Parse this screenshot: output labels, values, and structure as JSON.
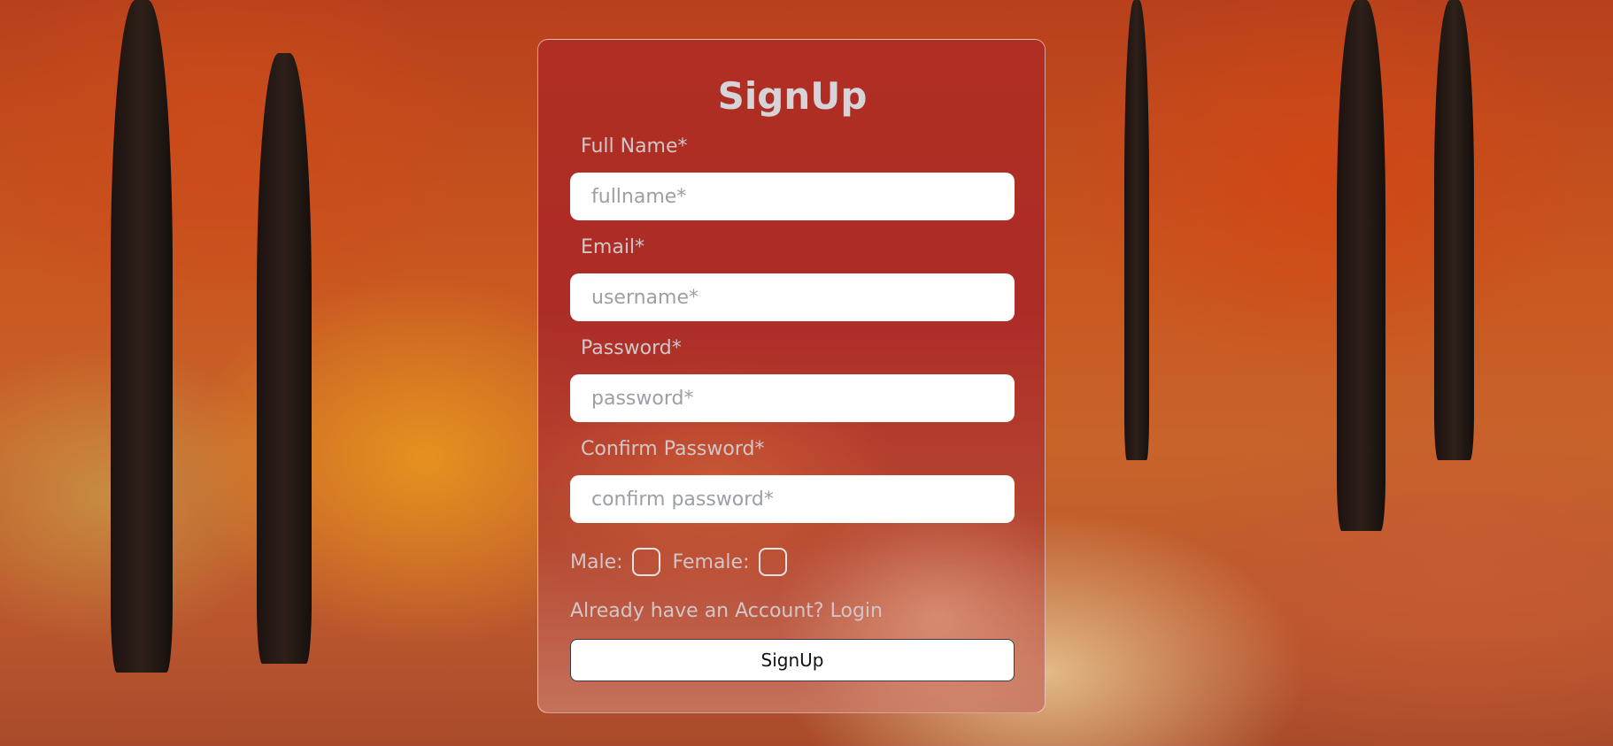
{
  "form": {
    "title": "SignUp",
    "fields": [
      {
        "label": "Full Name*",
        "placeholder": "fullname*",
        "value": ""
      },
      {
        "label": "Email*",
        "placeholder": "username*",
        "value": ""
      },
      {
        "label": "Password*",
        "placeholder": "password*",
        "value": ""
      },
      {
        "label": "Confirm Password*",
        "placeholder": "confirm password*",
        "value": ""
      }
    ],
    "gender": {
      "male_label": "Male:",
      "female_label": "Female:",
      "male_checked": false,
      "female_checked": false
    },
    "account_prompt": "Already have an Account?",
    "login_link": "Login",
    "submit_label": "SignUp"
  },
  "colors": {
    "card_bg": "#ad2d28",
    "label_text": "#d2c6c8",
    "title_text": "#d6d4d8",
    "input_bg": "#ffffff",
    "placeholder": "#9aa0a6"
  }
}
